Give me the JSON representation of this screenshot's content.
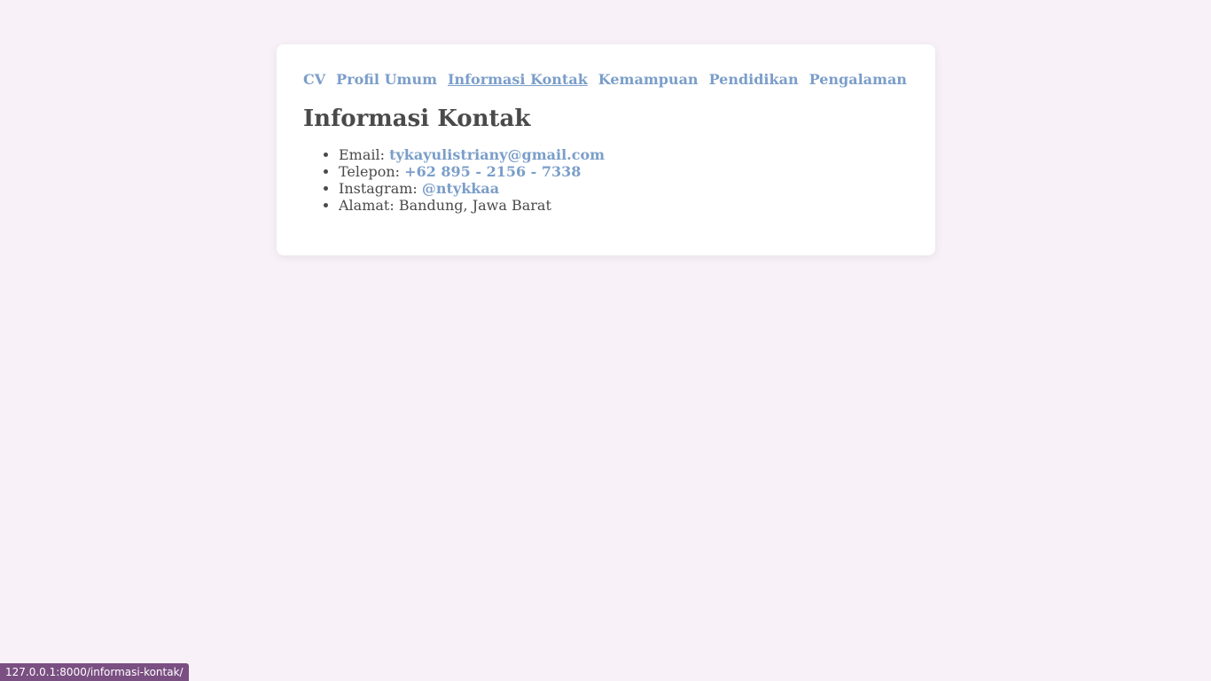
{
  "nav": {
    "items": [
      {
        "label": "CV"
      },
      {
        "label": "Profil Umum"
      },
      {
        "label": "Informasi Kontak"
      },
      {
        "label": "Kemampuan"
      },
      {
        "label": "Pendidikan"
      },
      {
        "label": "Pengalaman"
      }
    ]
  },
  "main": {
    "title": "Informasi Kontak",
    "contacts": [
      {
        "label": "Email:",
        "value": "tykayulistriany@gmail.com"
      },
      {
        "label": "Telepon:",
        "value": "+62 895 - 2156 - 7338"
      },
      {
        "label": "Instagram:",
        "value": "@ntykkaa"
      },
      {
        "label": "Alamat:",
        "value": "Bandung, Jawa Barat"
      }
    ]
  },
  "statusbar": {
    "url": "127.0.0.1:8000/informasi-kontak/"
  }
}
